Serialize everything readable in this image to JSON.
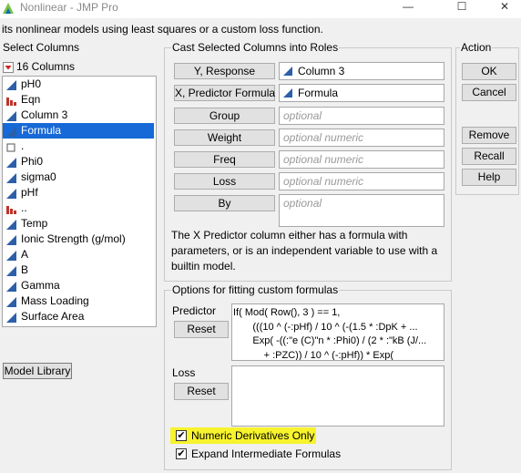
{
  "window": {
    "title": "Nonlinear - JMP Pro",
    "subtitle": "its nonlinear models using least squares or a custom loss function.",
    "minimize": "—",
    "maximize": "☐",
    "close": "✕"
  },
  "select_columns": {
    "label": "Select Columns",
    "count": "16 Columns",
    "items": [
      {
        "label": "pH0",
        "icon": "continuous-icon",
        "selected": false
      },
      {
        "label": "Eqn",
        "icon": "nominal-icon",
        "selected": false
      },
      {
        "label": "Column 3",
        "icon": "continuous-icon",
        "selected": false
      },
      {
        "label": "Formula",
        "icon": "continuous-icon",
        "selected": true
      },
      {
        "label": ".",
        "icon": "empty-icon",
        "selected": false
      },
      {
        "label": "Phi0",
        "icon": "continuous-icon",
        "selected": false
      },
      {
        "label": "sigma0",
        "icon": "continuous-icon",
        "selected": false
      },
      {
        "label": "pHf",
        "icon": "continuous-icon",
        "selected": false
      },
      {
        "label": "..",
        "icon": "nominal-icon",
        "selected": false
      },
      {
        "label": "Temp",
        "icon": "continuous-icon",
        "selected": false
      },
      {
        "label": "Ionic Strength (g/mol)",
        "icon": "continuous-icon",
        "selected": false
      },
      {
        "label": "A",
        "icon": "continuous-icon",
        "selected": false
      },
      {
        "label": "B",
        "icon": "continuous-icon",
        "selected": false
      },
      {
        "label": "Gamma",
        "icon": "continuous-icon",
        "selected": false
      },
      {
        "label": "Mass Loading",
        "icon": "continuous-icon",
        "selected": false
      },
      {
        "label": "Surface Area",
        "icon": "continuous-icon",
        "selected": false
      }
    ]
  },
  "roles": {
    "label": "Cast Selected Columns into Roles",
    "y_response": {
      "button": "Y, Response",
      "value": "Column 3"
    },
    "x_predictor": {
      "button": "X, Predictor Formula",
      "value": "Formula"
    },
    "group": {
      "button": "Group",
      "placeholder": "optional"
    },
    "weight": {
      "button": "Weight",
      "placeholder": "optional numeric"
    },
    "freq": {
      "button": "Freq",
      "placeholder": "optional numeric"
    },
    "loss": {
      "button": "Loss",
      "placeholder": "optional numeric"
    },
    "by": {
      "button": "By",
      "placeholder": "optional"
    },
    "note_line1": "The X Predictor column either has a formula with",
    "note_line2": "parameters, or is an independent variable to use with a",
    "note_line3": "builtin model."
  },
  "action": {
    "label": "Action",
    "ok": "OK",
    "cancel": "Cancel",
    "remove": "Remove",
    "recall": "Recall",
    "help": "Help"
  },
  "options": {
    "label": "Options for fitting custom formulas",
    "predictor_label": "Predictor",
    "predictor_reset": "Reset",
    "formula_lines": [
      "If( Mod( Row(), 3 ) == 1,",
      "       (((10 ^ (-:pHf) / 10 ^ (-(1.5 * :DpK + ...",
      "       Exp( -((:\"e (C)\"n * :Phi0) / (2 * :\"kB (J/...",
      "           + :PZC)) / 10 ^ (-:pHf)) * Exp("
    ],
    "loss_label": "Loss",
    "loss_reset": "Reset",
    "numeric_derivatives": {
      "label": "Numeric Derivatives Only",
      "checked": true
    },
    "expand_formulas": {
      "label": "Expand Intermediate Formulas",
      "checked": true
    }
  },
  "model_library": "Model Library",
  "colors": {
    "selection": "#1669d6",
    "highlight": "#f7f32d",
    "continuous": "#2c5fa8",
    "nominal": "#c0332b"
  }
}
